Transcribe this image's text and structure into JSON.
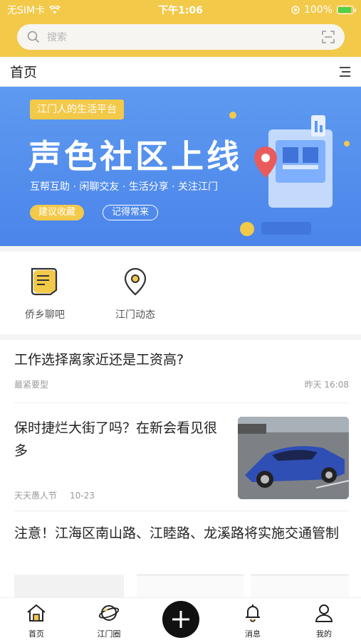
{
  "status_bar": {
    "carrier": "无SIM卡",
    "time": "下午1:06",
    "battery": "100%"
  },
  "search": {
    "placeholder": "搜索"
  },
  "title_bar": {
    "title": "首页"
  },
  "banner": {
    "tag": "江门人的生活平台",
    "headline": "声色社区上线",
    "subline": "互帮互助 · 闲聊交友 · 生活分享 · 关注江门",
    "button_primary": "建议收藏",
    "button_secondary": "记得常来"
  },
  "quick_menu": [
    {
      "label": "侨乡聊吧",
      "icon": "chat-note-icon"
    },
    {
      "label": "江门动态",
      "icon": "location-pin-icon"
    }
  ],
  "feed": [
    {
      "title": "工作选择离家近还是工资高?",
      "author": "最紧要型",
      "time": "昨天 16:08"
    },
    {
      "title": "保时捷烂大街了吗？在新会看见很多",
      "author": "天天愚人节",
      "time": "10-23",
      "thumbnail": "blue-sports-car-photo"
    },
    {
      "title": "注意！江海区南山路、江睦路、龙溪路将实施交通管制"
    }
  ],
  "tab_bar": [
    {
      "label": "首页",
      "icon": "home-icon"
    },
    {
      "label": "江门圈",
      "icon": "planet-icon"
    },
    {
      "label": "",
      "icon": "plus-icon"
    },
    {
      "label": "消息",
      "icon": "bell-icon"
    },
    {
      "label": "我的",
      "icon": "user-icon"
    }
  ],
  "colors": {
    "accent": "#f3c94a",
    "banner_blue": "#4b85ea"
  }
}
